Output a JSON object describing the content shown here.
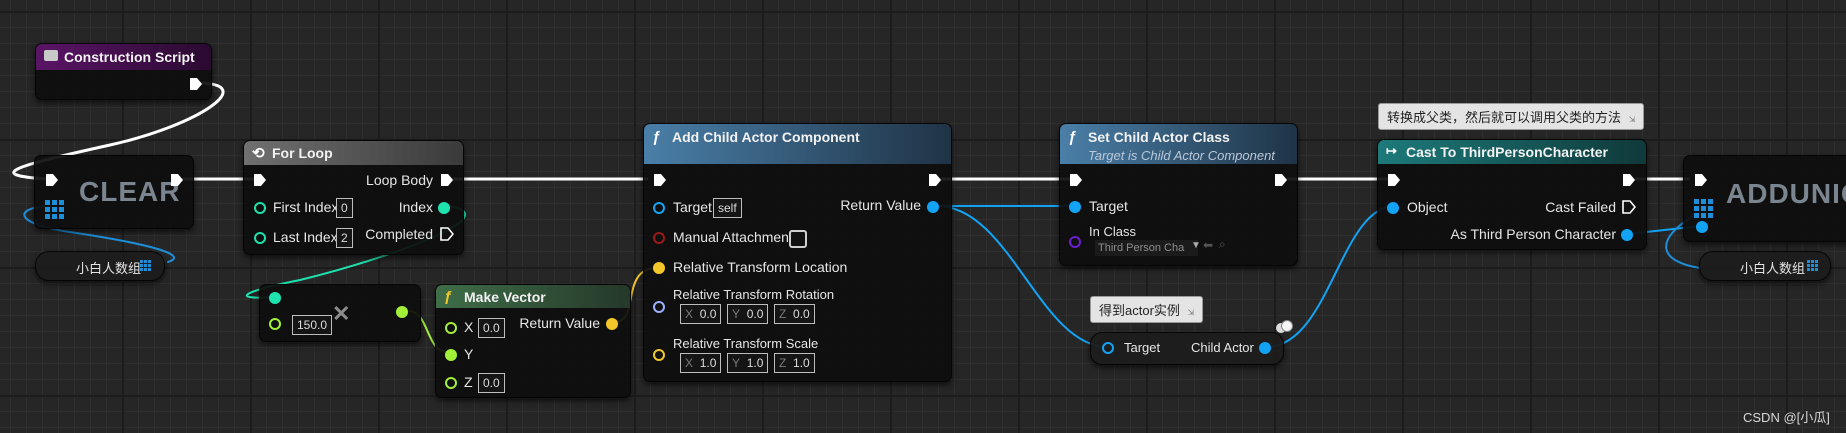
{
  "construction_script": {
    "title": "Construction Script"
  },
  "clear_node": {
    "ghost": "CLEAR"
  },
  "array_var_left": {
    "label": "小白人数组"
  },
  "for_loop": {
    "title": "For Loop",
    "first_index_label": "First Index",
    "first_index_value": "0",
    "last_index_label": "Last Index",
    "last_index_value": "2",
    "loop_body_label": "Loop Body",
    "index_label": "Index",
    "completed_label": "Completed"
  },
  "multiply_node": {
    "value": "150.0"
  },
  "make_vector": {
    "title": "Make Vector",
    "x_label": "X",
    "x_value": "0.0",
    "y_label": "Y",
    "z_label": "Z",
    "z_value": "0.0",
    "return_label": "Return Value"
  },
  "add_child_actor": {
    "title": "Add Child Actor Component",
    "target_label": "Target",
    "target_value": "self",
    "manual_label": "Manual Attachment",
    "loc_label": "Relative Transform Location",
    "rot_label": "Relative Transform Rotation",
    "scale_label": "Relative Transform Scale",
    "axis_x": "X",
    "axis_y": "Y",
    "axis_z": "Z",
    "rot_values": [
      "0.0",
      "0.0",
      "0.0"
    ],
    "scale_values": [
      "1.0",
      "1.0",
      "1.0"
    ],
    "return_label": "Return Value"
  },
  "set_child_actor_class": {
    "title": "Set Child Actor Class",
    "subtitle": "Target is Child Actor Component",
    "target_label": "Target",
    "in_class_label": "In Class",
    "in_class_value": "Third Person Cha"
  },
  "child_actor_getter": {
    "comment": "得到actor实例",
    "target_label": "Target",
    "output_label": "Child Actor"
  },
  "cast_node": {
    "comment": "转换成父类，然后就可以调用父类的方法",
    "title": "Cast To ThirdPersonCharacter",
    "object_label": "Object",
    "cast_failed_label": "Cast Failed",
    "as_label": "As Third Person Character"
  },
  "add_unique_node": {
    "ghost": "ADDUNIQU"
  },
  "array_var_right": {
    "label": "小白人数组"
  },
  "watermark": "CSDN @[小瓜]",
  "colors": {
    "exec": "#ffffff",
    "object": "#12a3f4",
    "int": "#1fe3af",
    "float": "#a2f03a",
    "vector": "#f2c72a",
    "rotator": "#9db0ff",
    "class": "#6a1ed0",
    "bool": "#9a1a1a"
  }
}
